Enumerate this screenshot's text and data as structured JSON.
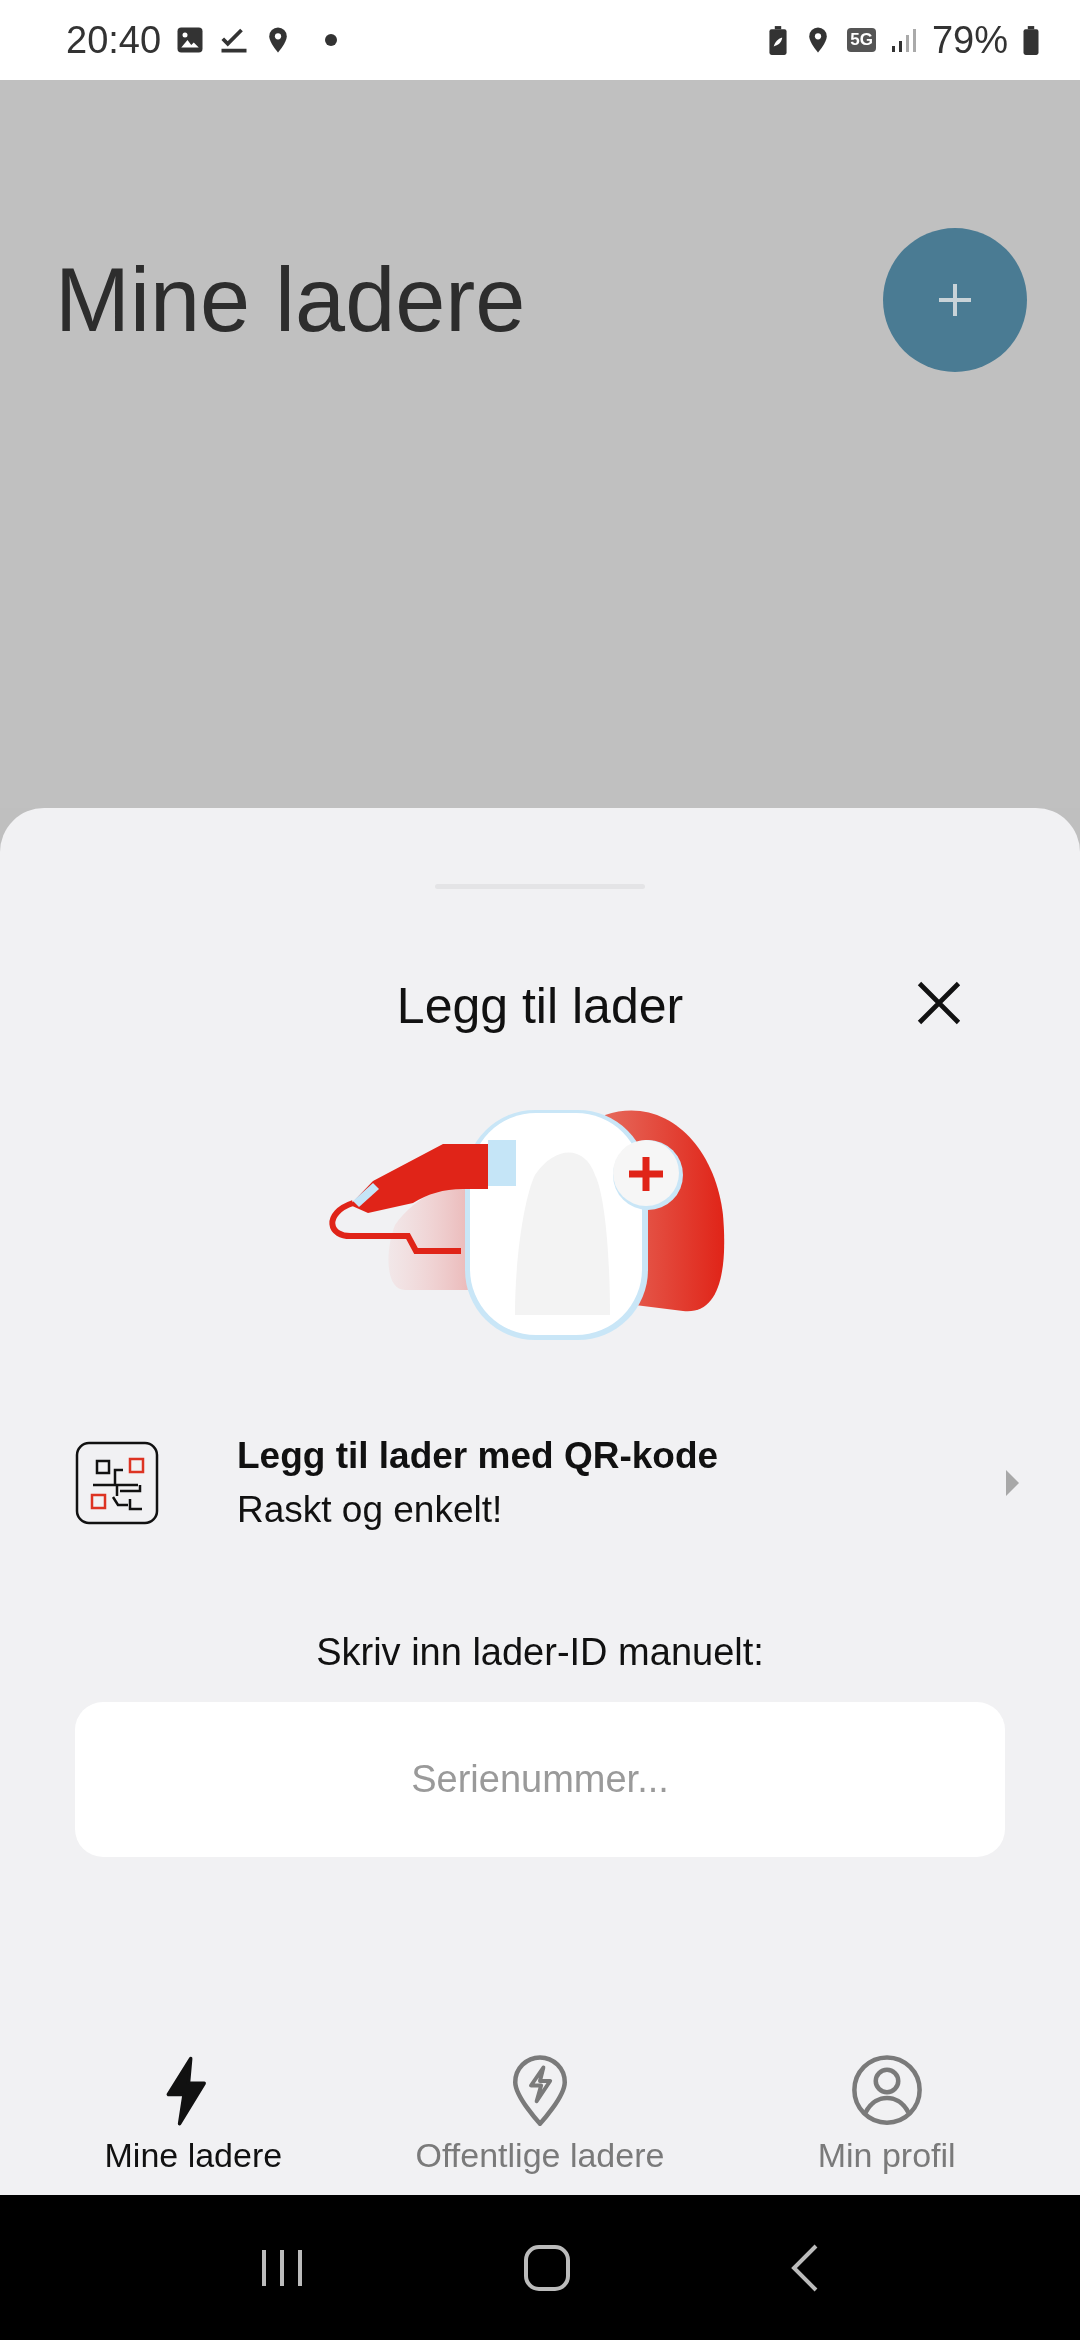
{
  "status_bar": {
    "time": "20:40",
    "network": "5G",
    "battery": "79%"
  },
  "page": {
    "title": "Mine ladere"
  },
  "sheet": {
    "title": "Legg til lader",
    "qr_option": {
      "title": "Legg til lader med QR-kode",
      "subtitle": "Raskt og enkelt!"
    },
    "manual_label": "Skriv inn lader-ID manuelt:",
    "serial_field": {
      "placeholder": "Serienummer..."
    }
  },
  "bottom_nav": [
    {
      "label": "Mine ladere",
      "kind": "bolt",
      "selected": true
    },
    {
      "label": "Offentlige ladere",
      "kind": "pin",
      "selected": false
    },
    {
      "label": "Min profil",
      "kind": "profile",
      "selected": false
    }
  ]
}
